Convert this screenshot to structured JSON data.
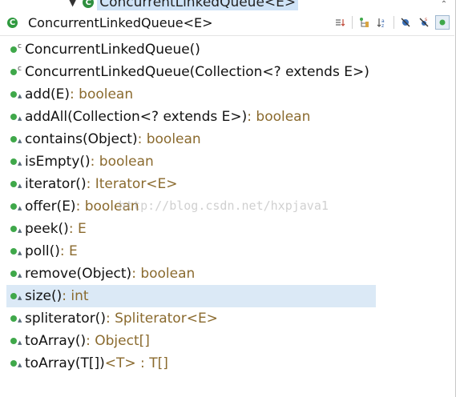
{
  "breadcrumb": {
    "class_name": "ConcurrentLinkedQueue<E>"
  },
  "header": {
    "title": "ConcurrentLinkedQueue<E>"
  },
  "members": [
    {
      "modifier": "c",
      "signature": "ConcurrentLinkedQueue()",
      "return_type": ""
    },
    {
      "modifier": "c",
      "signature": "ConcurrentLinkedQueue(Collection<? extends E>)",
      "return_type": ""
    },
    {
      "modifier": "a",
      "signature": "add(E)",
      "return_type": " : boolean"
    },
    {
      "modifier": "a",
      "signature": "addAll(Collection<? extends E>)",
      "return_type": " : boolean"
    },
    {
      "modifier": "a",
      "signature": "contains(Object)",
      "return_type": " : boolean"
    },
    {
      "modifier": "a",
      "signature": "isEmpty()",
      "return_type": " : boolean"
    },
    {
      "modifier": "a",
      "signature": "iterator()",
      "return_type": " : Iterator<E>"
    },
    {
      "modifier": "a",
      "signature": "offer(E)",
      "return_type": " : boolean"
    },
    {
      "modifier": "a",
      "signature": "peek()",
      "return_type": " : E"
    },
    {
      "modifier": "a",
      "signature": "poll()",
      "return_type": " : E"
    },
    {
      "modifier": "a",
      "signature": "remove(Object)",
      "return_type": " : boolean"
    },
    {
      "modifier": "a",
      "signature": "size()",
      "return_type": " : int"
    },
    {
      "modifier": "a",
      "signature": "spliterator()",
      "return_type": " : Spliterator<E>"
    },
    {
      "modifier": "a",
      "signature": "toArray()",
      "return_type": " : Object[]"
    },
    {
      "modifier": "a",
      "signature": "toArray(T[])",
      "return_type": " <T> : T[]"
    }
  ],
  "selected_index": 11,
  "watermark": "http://blog.csdn.net/hxpjava1",
  "colors": {
    "public_dot": "#3fa84a",
    "selection": "#dbe9f6",
    "return_type": "#8a6a2e"
  },
  "toolbar_icons": [
    "sort-icon",
    "hierarchy-icon",
    "sort-alpha-icon",
    "hide-fields-icon",
    "hide-static-icon",
    "hide-nonpublic-icon"
  ]
}
